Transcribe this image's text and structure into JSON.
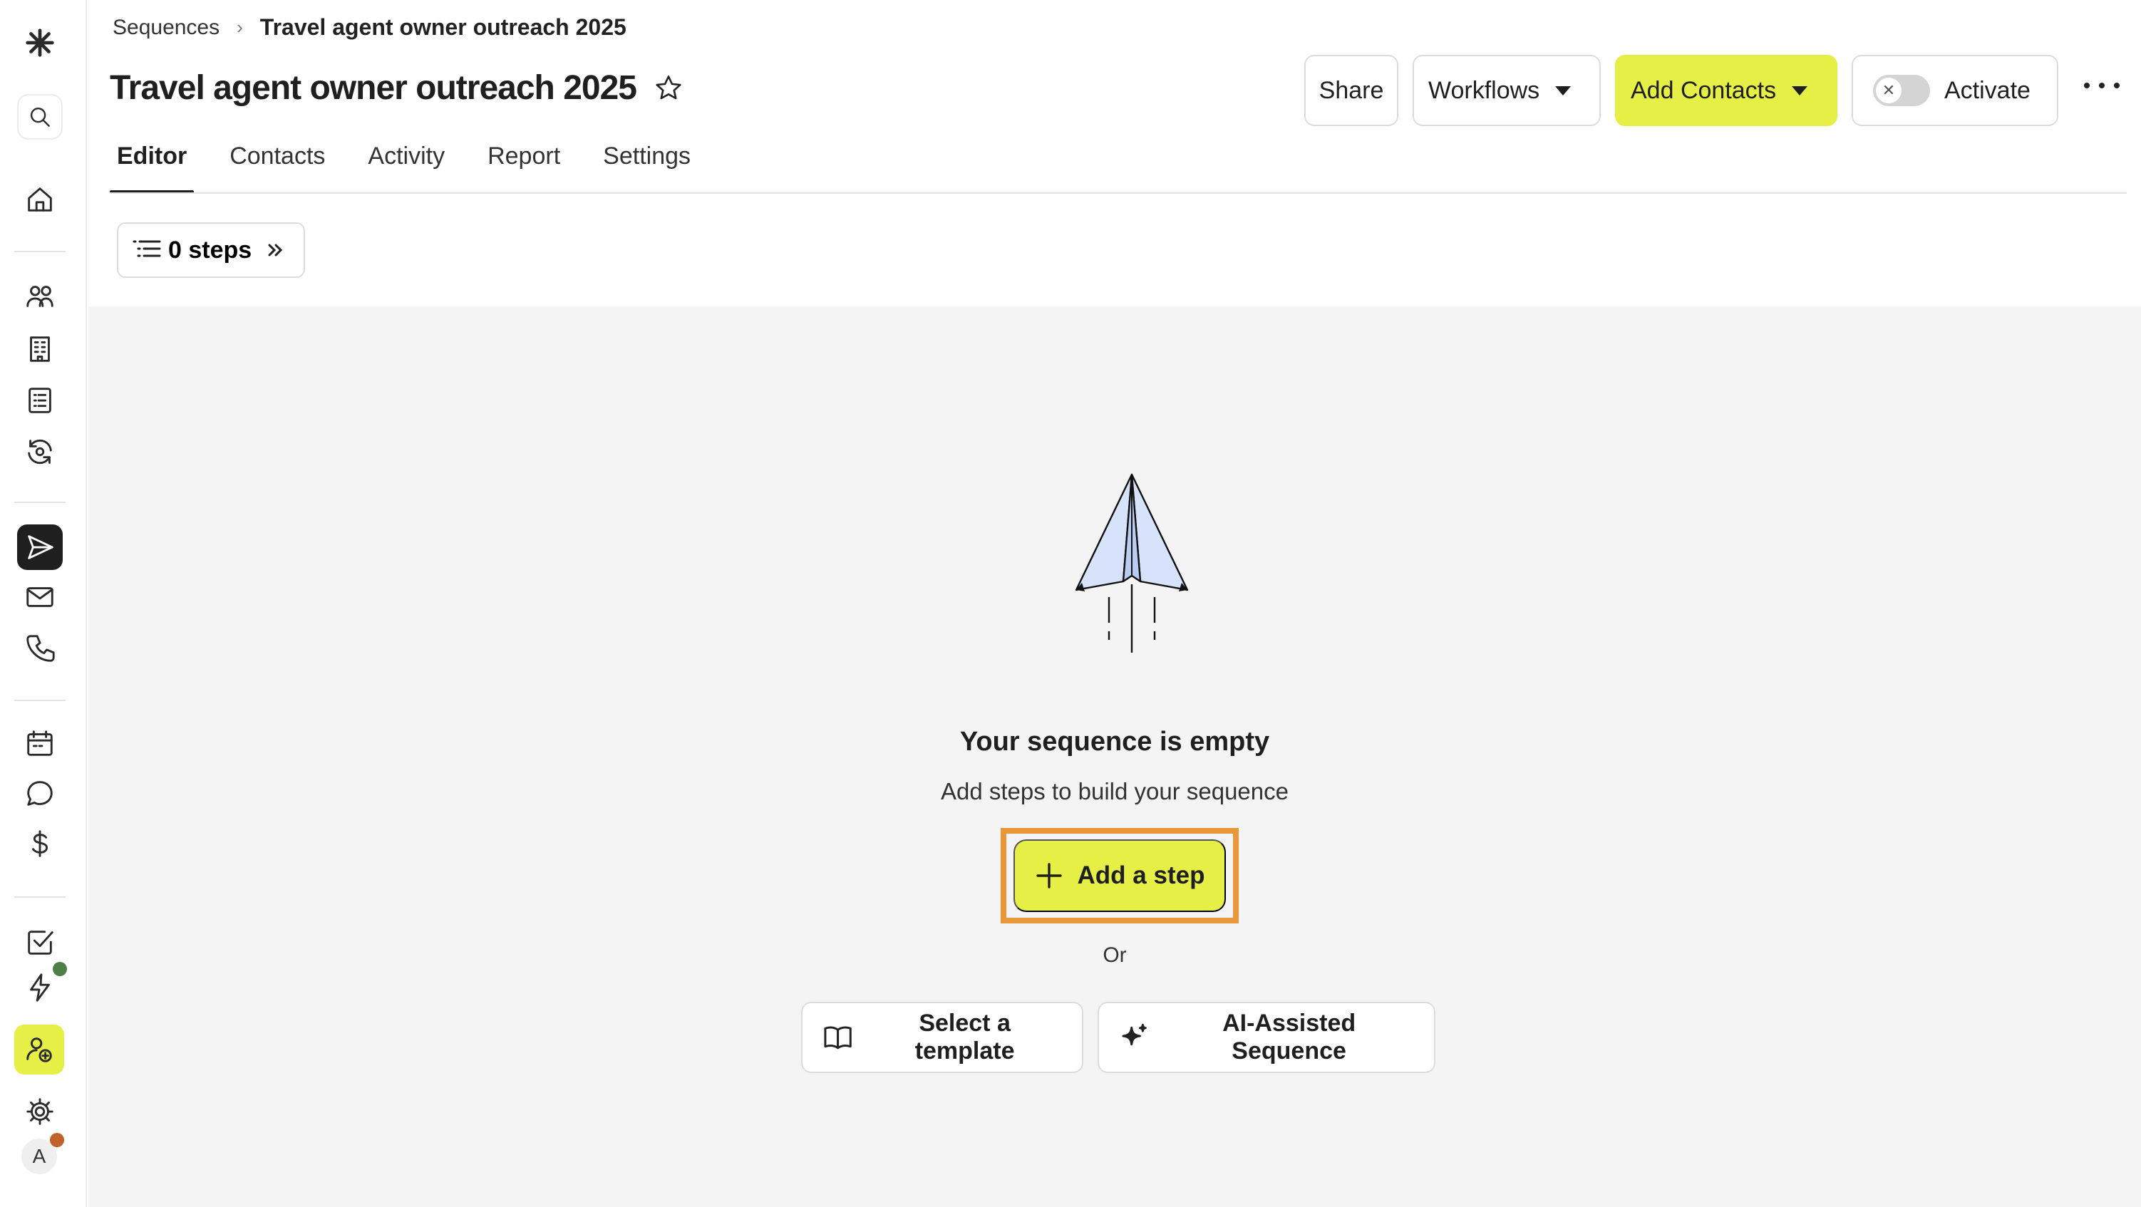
{
  "breadcrumb": {
    "parent": "Sequences",
    "separator": "›",
    "current": "Travel agent owner outreach 2025"
  },
  "page": {
    "title": "Travel agent owner outreach 2025"
  },
  "toolbar": {
    "share": "Share",
    "workflows": "Workflows",
    "add_contacts": "Add Contacts",
    "activate": "Activate",
    "activate_on": false
  },
  "tabs": [
    {
      "label": "Editor",
      "active": true
    },
    {
      "label": "Contacts",
      "active": false
    },
    {
      "label": "Activity",
      "active": false
    },
    {
      "label": "Report",
      "active": false
    },
    {
      "label": "Settings",
      "active": false
    }
  ],
  "steps_button": {
    "label": "0 steps"
  },
  "empty_state": {
    "title": "Your sequence is empty",
    "subtitle": "Add steps to build your sequence",
    "add_step": "Add a step",
    "or": "Or",
    "select_template": "Select a template",
    "ai_sequence": "AI-Assisted Sequence"
  },
  "sidebar": {
    "icons": [
      "logo-icon",
      "search-icon",
      "home-icon",
      "people-icon",
      "building-icon",
      "list-icon",
      "refresh-icon",
      "send-icon",
      "mail-icon",
      "phone-icon",
      "calendar-icon",
      "chat-icon",
      "dollar-icon",
      "task-icon",
      "bolt-icon",
      "add-user-icon",
      "gear-icon"
    ],
    "avatar_initial": "A"
  },
  "colors": {
    "accent": "#e5ef45",
    "highlight": "#e8973a",
    "status_green": "#4e7f46",
    "status_orange": "#c0612b"
  }
}
